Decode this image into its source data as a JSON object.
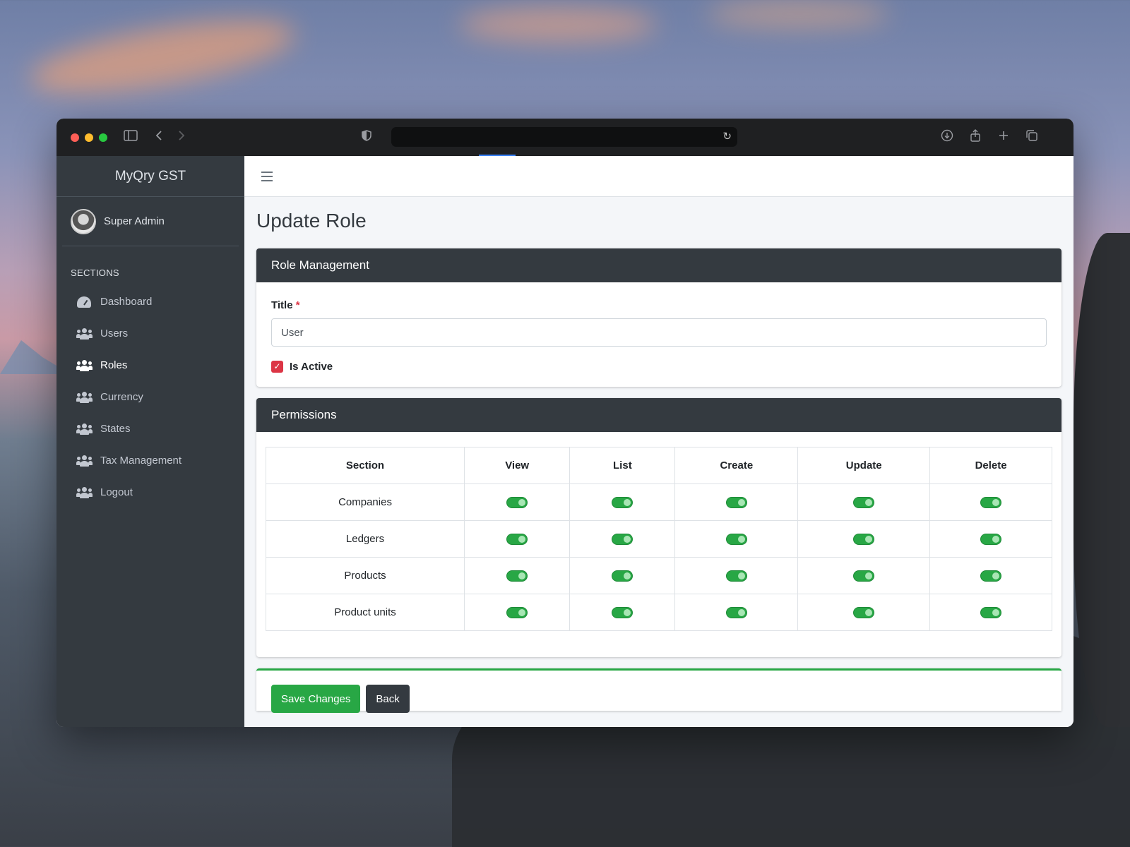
{
  "app": {
    "brand": "MyQry GST",
    "user_name": "Super Admin"
  },
  "sidebar": {
    "section_header": "SECTIONS",
    "items": [
      {
        "label": "Dashboard",
        "icon": "dashboard-icon"
      },
      {
        "label": "Users",
        "icon": "users-icon"
      },
      {
        "label": "Roles",
        "icon": "users-icon",
        "active": true
      },
      {
        "label": "Currency",
        "icon": "users-icon"
      },
      {
        "label": "States",
        "icon": "users-icon"
      },
      {
        "label": "Tax Management",
        "icon": "users-icon"
      },
      {
        "label": "Logout",
        "icon": "users-icon"
      }
    ]
  },
  "page": {
    "title": "Update Role"
  },
  "role_card": {
    "header": "Role Management",
    "title_label": "Title",
    "required_mark": "*",
    "title_value": "User",
    "is_active_label": "Is Active",
    "is_active": true
  },
  "permissions": {
    "header": "Permissions",
    "columns": [
      "Section",
      "View",
      "List",
      "Create",
      "Update",
      "Delete"
    ],
    "rows": [
      {
        "section": "Companies",
        "view": true,
        "list": true,
        "create": true,
        "update": true,
        "delete": true
      },
      {
        "section": "Ledgers",
        "view": true,
        "list": true,
        "create": true,
        "update": true,
        "delete": true
      },
      {
        "section": "Products",
        "view": true,
        "list": true,
        "create": true,
        "update": true,
        "delete": true
      },
      {
        "section": "Product units",
        "view": true,
        "list": true,
        "create": true,
        "update": true,
        "delete": true
      }
    ]
  },
  "actions": {
    "save_label": "Save Changes",
    "back_label": "Back"
  },
  "colors": {
    "sidebar_bg": "#343a40",
    "card_header_bg": "#343a40",
    "toggle_on": "#28a745",
    "checkbox": "#dc3545",
    "save_button": "#28a745"
  }
}
